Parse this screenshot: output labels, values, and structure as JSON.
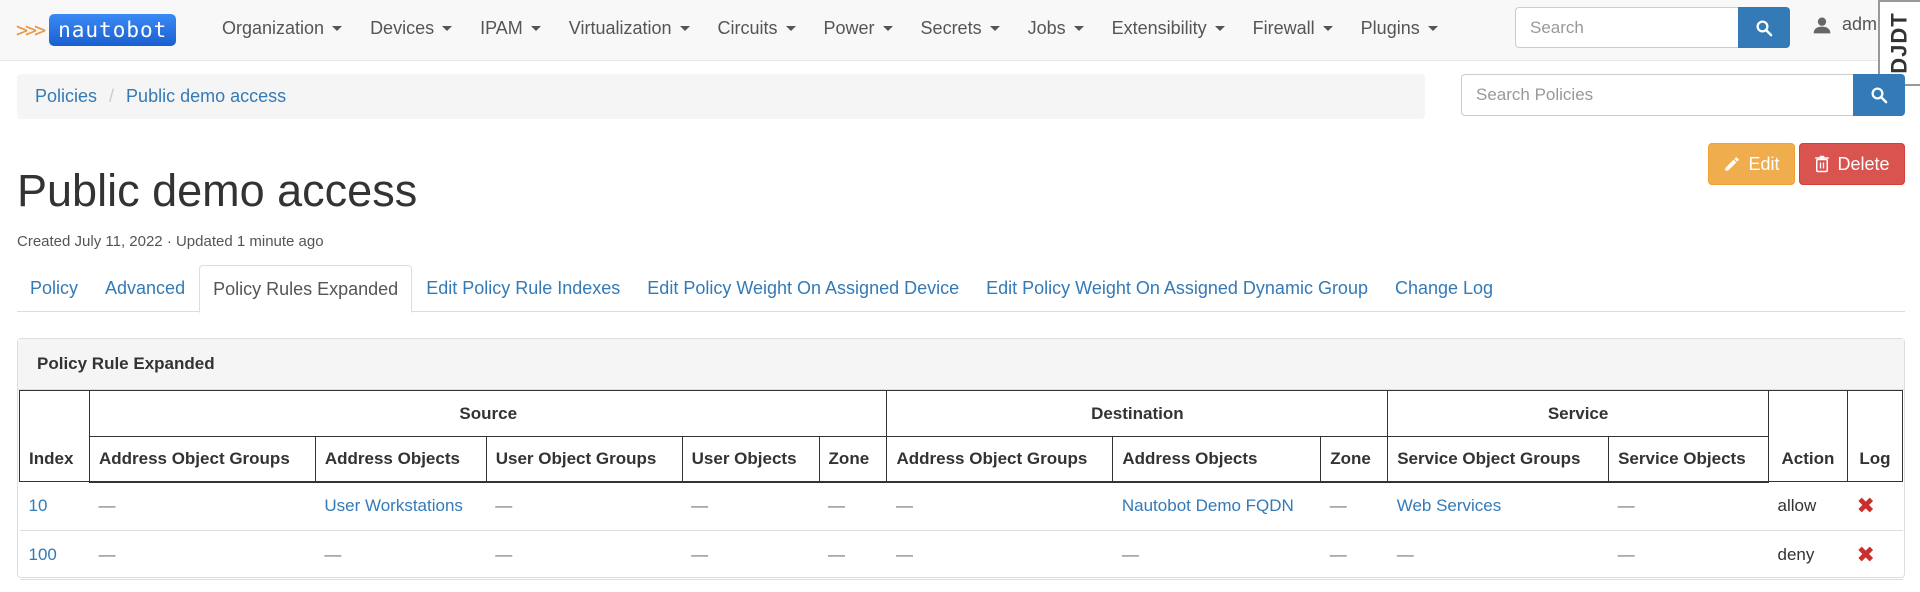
{
  "app": {
    "brand_arrows": ">>>",
    "brand_name": "nautobot",
    "nav": [
      "Organization",
      "Devices",
      "IPAM",
      "Virtualization",
      "Circuits",
      "Power",
      "Secrets",
      "Jobs",
      "Extensibility",
      "Firewall",
      "Plugins"
    ],
    "search_placeholder": "Search",
    "user_label": "adm",
    "djdt_label": "DJDT"
  },
  "breadcrumb": {
    "items": [
      "Policies",
      "Public demo access"
    ],
    "search_placeholder": "Search Policies"
  },
  "actions": {
    "edit_label": "Edit",
    "delete_label": "Delete"
  },
  "page": {
    "title": "Public demo access",
    "meta": "Created July 11, 2022 · Updated 1 minute ago"
  },
  "tabs": [
    "Policy",
    "Advanced",
    "Policy Rules Expanded",
    "Edit Policy Rule Indexes",
    "Edit Policy Weight On Assigned Device",
    "Edit Policy Weight On Assigned Dynamic Group",
    "Change Log"
  ],
  "active_tab": "Policy Rules Expanded",
  "panel": {
    "title": "Policy Rule Expanded",
    "group_headers": {
      "source": "Source",
      "destination": "Destination",
      "service": "Service"
    },
    "columns": [
      "Index",
      "Address Object Groups",
      "Address Objects",
      "User Object Groups",
      "User Objects",
      "Zone",
      "Address Object Groups",
      "Address Objects",
      "Zone",
      "Service Object Groups",
      "Service Objects",
      "Action",
      "Log"
    ],
    "rows": [
      {
        "index": "10",
        "src_addr_groups": "—",
        "src_addr_objects": "User Workstations",
        "src_user_groups": "—",
        "src_user_objects": "—",
        "src_zone": "—",
        "dst_addr_groups": "—",
        "dst_addr_objects": "Nautobot Demo FQDN",
        "dst_zone": "—",
        "svc_groups": "Web Services",
        "svc_objects": "—",
        "action": "allow",
        "log": "✖"
      },
      {
        "index": "100",
        "src_addr_groups": "—",
        "src_addr_objects": "—",
        "src_user_groups": "—",
        "src_user_objects": "—",
        "src_zone": "—",
        "dst_addr_groups": "—",
        "dst_addr_objects": "—",
        "dst_zone": "—",
        "svc_groups": "—",
        "svc_objects": "—",
        "action": "deny",
        "log": "✖"
      }
    ]
  },
  "colors": {
    "link": "#337ab7",
    "edit": "#f0ad4e",
    "delete": "#d9534f",
    "log_false": "#c9302c"
  }
}
